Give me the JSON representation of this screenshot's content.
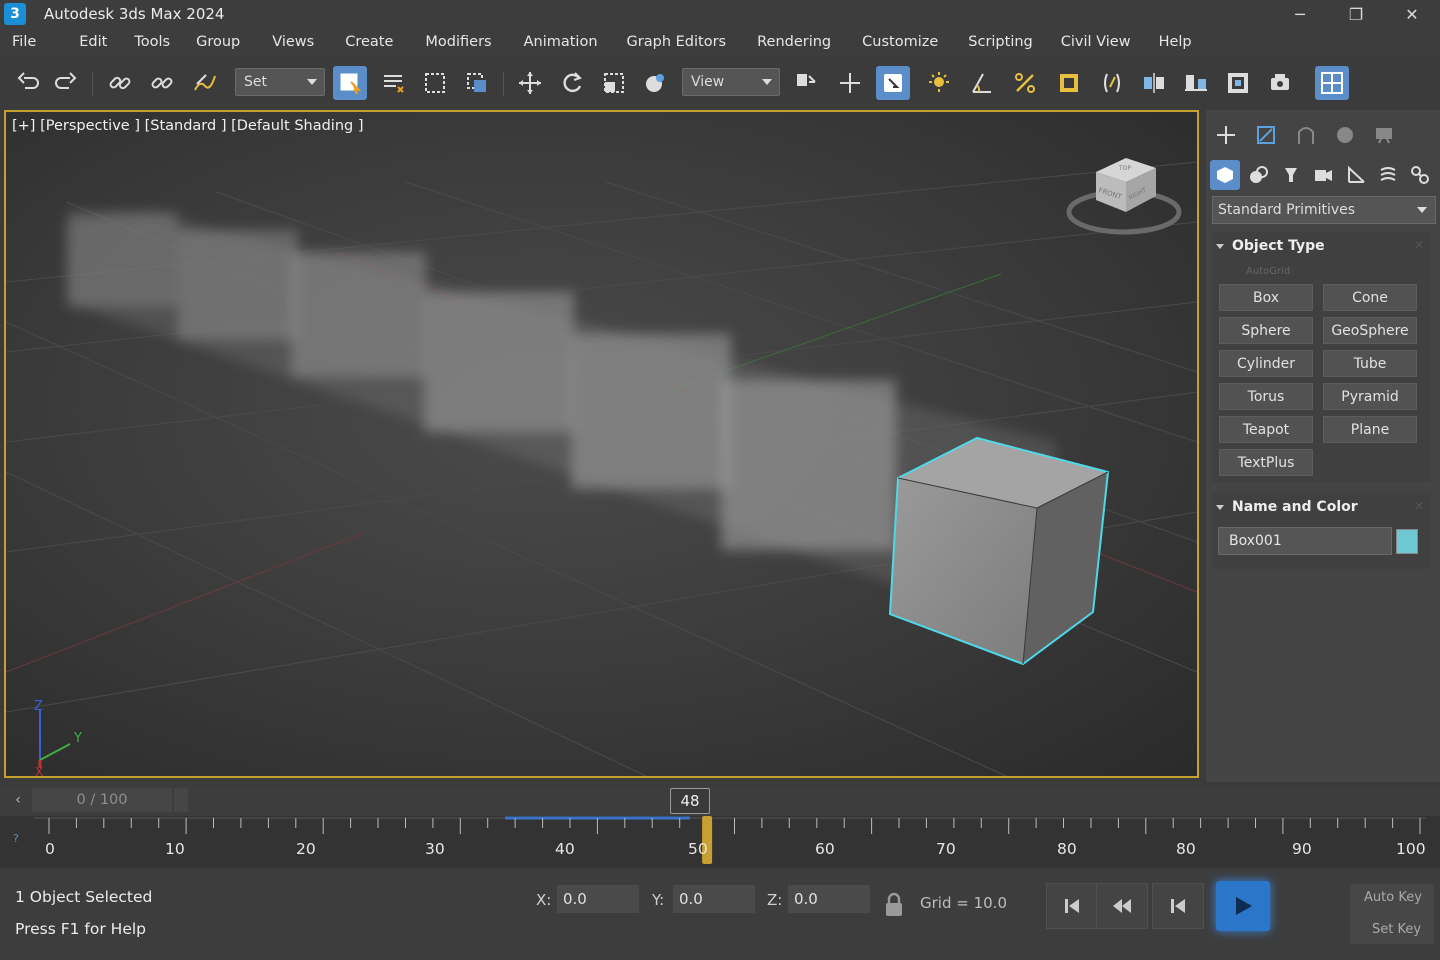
{
  "window": {
    "app_icon_label": "3",
    "title": "Autodesk 3ds Max 2024",
    "controls": [
      "─",
      "❐",
      "✕"
    ]
  },
  "menu": {
    "items": [
      "File",
      "Edit",
      "Tools",
      "Group",
      "Views",
      "Create",
      "Modifiers",
      "Animation",
      "Graph Editors",
      "Rendering",
      "Customize",
      "Scripting",
      "Civil View",
      "Help"
    ]
  },
  "toolbar": {
    "selection_set": "Set",
    "reference_coord": "View",
    "icons": [
      "undo-icon",
      "redo-icon",
      "link-icon",
      "unlink-icon",
      "bind-spacewarp-icon",
      "select-object-icon",
      "select-by-name-icon",
      "rect-selection-icon",
      "window-crossing-icon",
      "move-icon",
      "rotate-icon",
      "scale-icon",
      "select-place-icon",
      "pivot-icon",
      "manipulate-icon",
      "snap-toggle-icon",
      "angle-snap-icon",
      "percent-snap-icon",
      "spinner-snap-icon",
      "named-sets-icon",
      "mirror-icon",
      "align-icon",
      "layer-explorer-icon",
      "render-setup-icon",
      "viewport-layout-icon"
    ]
  },
  "viewport": {
    "label": "[+] [Perspective ] [Standard ] [Default Shading ]",
    "viewcube": {
      "top": "TOP",
      "front": "FRONT",
      "right": "RIGHT"
    },
    "axes": {
      "x": "X",
      "y": "Y",
      "z": "Z"
    },
    "selection_color": "#4fd8e6",
    "border_color": "#c8a032"
  },
  "command_panel": {
    "tabs": [
      "create-tab-icon",
      "modify-tab-icon",
      "hierarchy-tab-icon",
      "motion-tab-icon",
      "display-tab-icon"
    ],
    "categories": [
      "geometry-icon",
      "shapes-icon",
      "lights-icon",
      "cameras-icon",
      "helpers-icon",
      "spacewarps-icon",
      "systems-icon"
    ],
    "dropdown": "Standard Primitives",
    "object_type": {
      "title": "Object Type",
      "autogrid": "AutoGrid",
      "buttons": [
        "Box",
        "Cone",
        "Sphere",
        "GeoSphere",
        "Cylinder",
        "Tube",
        "Torus",
        "Pyramid",
        "Teapot",
        "Plane",
        "TextPlus"
      ]
    },
    "name_and_color": {
      "title": "Name and Color",
      "name": "Box001",
      "color": "#6ec8d4"
    }
  },
  "timeline": {
    "range": "0 / 100",
    "current_frame": "48",
    "current_frame_value": 48,
    "labels": [
      "0",
      "10",
      "20",
      "30",
      "40",
      "50",
      "60",
      "70",
      "80",
      "80",
      "90",
      "100"
    ],
    "left_glyph": "‹",
    "track_glyph": "?"
  },
  "status": {
    "selection": "1 Object Selected",
    "prompt": "Press F1 for Help",
    "x_label": "X:",
    "x_value": "0.0",
    "y_label": "Y:",
    "y_value": "0.0",
    "z_label": "Z:",
    "z_value": "0.0",
    "grid": "Grid = 10.0",
    "auto_key": "Auto Key",
    "set_key": "Set Key"
  }
}
